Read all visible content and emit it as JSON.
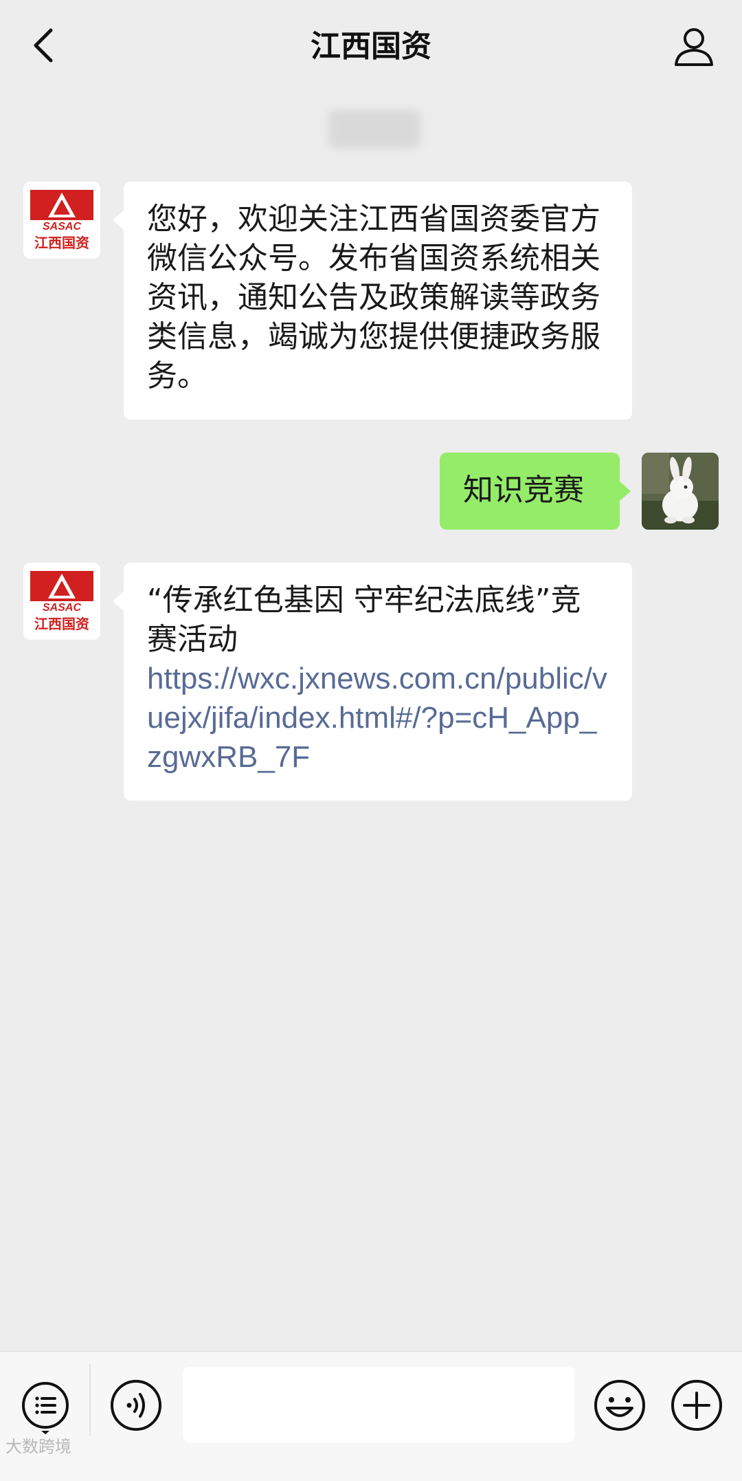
{
  "header": {
    "title": "江西国资",
    "back_icon": "chevron-left-icon",
    "profile_icon": "person-icon"
  },
  "messages": [
    {
      "side": "left",
      "avatar": {
        "logo_top": "SASAC",
        "logo_bottom": "江西国资"
      },
      "text": "您好，欢迎关注江西省国资委官方微信公众号。发布省国资系统相关资讯，通知公告及政策解读等政务类信息，竭诚为您提供便捷政务服务。"
    },
    {
      "side": "right",
      "avatar": {
        "description": "rabbit-photo"
      },
      "text": "知识竞赛"
    },
    {
      "side": "left",
      "avatar": {
        "logo_top": "SASAC",
        "logo_bottom": "江西国资"
      },
      "text": "“传承红色基因  守牢纪法底线”竞赛活动",
      "link": "https://wxc.jxnews.com.cn/public/vuejx/jifa/index.html#/?p=cH_App_zgwxRB_7F"
    }
  ],
  "input_bar": {
    "menu_icon": "list-icon",
    "voice_icon": "voice-icon",
    "input_value": "",
    "emoji_icon": "smiley-icon",
    "plus_icon": "plus-icon"
  },
  "watermark": "大数跨境",
  "colors": {
    "background": "#ededed",
    "bubble_left": "#ffffff",
    "bubble_right": "#95ec69",
    "link": "#586b95",
    "logo_red": "#d0201f"
  }
}
